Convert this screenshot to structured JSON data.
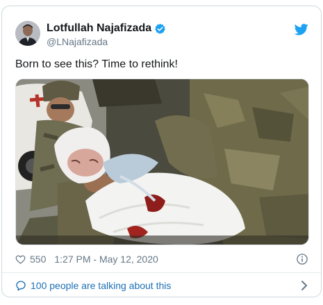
{
  "tweet": {
    "display_name": "Lotfullah Najafizada",
    "handle": "@LNajafizada",
    "text": "Born to see this? Time to rethink!",
    "likes": "550",
    "timestamp": "1:27 PM - May 12, 2020",
    "talking": "100 people are talking about this"
  },
  "icons": {
    "verified": "verified-badge-icon",
    "brand": "twitter-bird-icon",
    "like": "heart-icon",
    "info": "info-icon",
    "reply": "speech-bubble-icon",
    "more": "chevron-right-icon"
  },
  "colors": {
    "brand_blue": "#1da1f2",
    "link_blue": "#1b6fb5",
    "text_primary": "#14171a",
    "text_secondary": "#657786",
    "border": "#cfd9de"
  }
}
